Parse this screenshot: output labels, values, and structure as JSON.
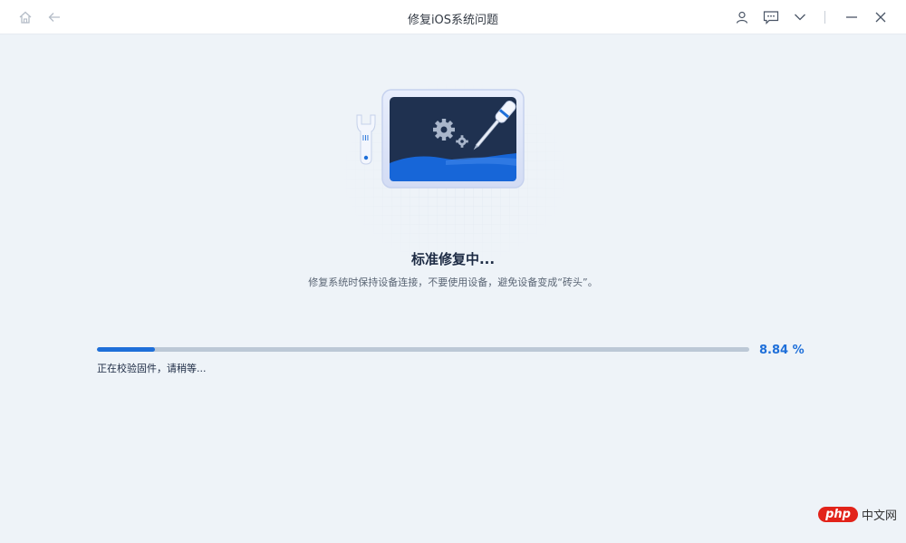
{
  "window": {
    "title": "修复iOS系统问题"
  },
  "status": {
    "title": "标准修复中...",
    "subtitle": "修复系统时保持设备连接，不要使用设备，避免设备变成“砖头”。"
  },
  "progress": {
    "fraction": 0.0884,
    "percent_label": "8.84 %",
    "message": "正在校验固件，请稍等..."
  },
  "watermark": {
    "brand": "php",
    "site": "中文网"
  },
  "colors": {
    "accent": "#1e6fd9",
    "background": "#eef3f8",
    "track": "#bcc8d6"
  },
  "icons": [
    "home-icon",
    "back-arrow-icon",
    "user-icon",
    "feedback-icon",
    "chevron-down-icon",
    "minimize-icon",
    "close-icon"
  ]
}
